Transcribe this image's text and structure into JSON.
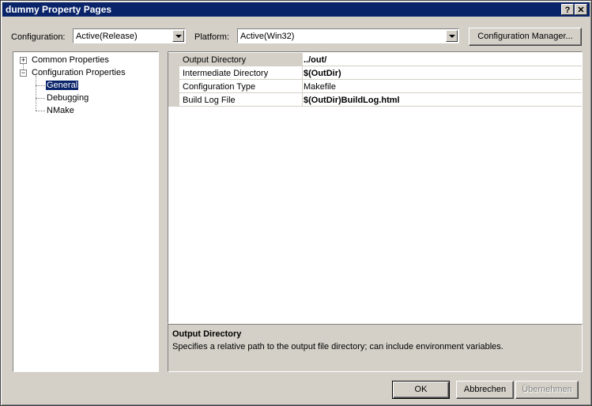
{
  "window": {
    "title": "dummy Property Pages",
    "help_label": "?",
    "close_label": "✕"
  },
  "config": {
    "label": "Configuration:",
    "value": "Active(Release)"
  },
  "platform": {
    "label": "Platform:",
    "value": "Active(Win32)"
  },
  "config_manager_label": "Configuration Manager...",
  "tree": {
    "common": "Common Properties",
    "config_props": "Configuration Properties",
    "general": "General",
    "debugging": "Debugging",
    "nmake": "NMake",
    "expander_plus": "+",
    "expander_minus": "−"
  },
  "grid": {
    "rows": [
      {
        "name": "Output Directory",
        "value": "../out/"
      },
      {
        "name": "Intermediate Directory",
        "value": "$(OutDir)"
      },
      {
        "name": "Configuration Type",
        "value": "Makefile"
      },
      {
        "name": "Build Log File",
        "value": "$(OutDir)BuildLog.html"
      }
    ]
  },
  "description": {
    "title": "Output Directory",
    "text": "Specifies a relative path to the output file directory; can include environment variables."
  },
  "buttons": {
    "ok": "OK",
    "cancel": "Abbrechen",
    "apply": "Übernehmen"
  },
  "colors": {
    "titlebar": "#0a246a",
    "dialog_bg": "#d4d0c8",
    "selection": "#0a246a"
  }
}
